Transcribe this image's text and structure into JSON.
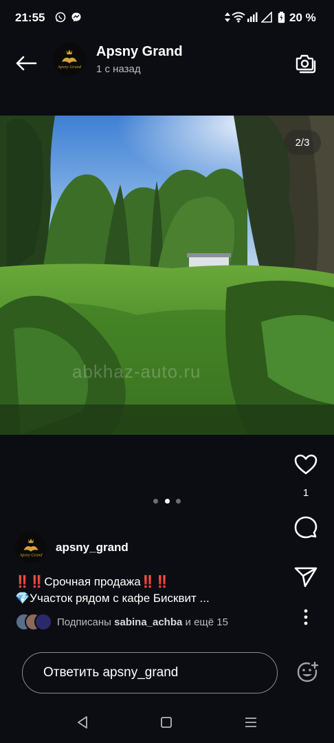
{
  "status_bar": {
    "time": "21:55",
    "battery_percent": "20 %",
    "icons": [
      "whatsapp-icon",
      "messenger-icon",
      "data-arrows-icon",
      "wifi-icon",
      "signal-icon",
      "signal-empty-icon",
      "battery-icon"
    ]
  },
  "header": {
    "title": "Apsny Grand",
    "subtitle": "1 с назад",
    "avatar_text": "Apsny Grand"
  },
  "story": {
    "page_indicator": "2/3",
    "watermark": "abkhaz-auto.ru",
    "current_page": 2,
    "total_pages": 3
  },
  "actions": {
    "like_count": "1"
  },
  "author": {
    "username": "apsny_grand",
    "avatar_text": "Apsny Grand"
  },
  "caption": {
    "line1": "‼️‼️Срочная продажа‼️‼️",
    "line2": "💎Участок рядом с кафе Бисквит ..."
  },
  "followers": {
    "prefix": "Подписаны",
    "name": "sabina_achba",
    "suffix": "и ещё 15"
  },
  "reply": {
    "placeholder": "Ответить apsny_grand"
  },
  "colors": {
    "background": "#0b0d12",
    "gold": "#d4a43a"
  }
}
